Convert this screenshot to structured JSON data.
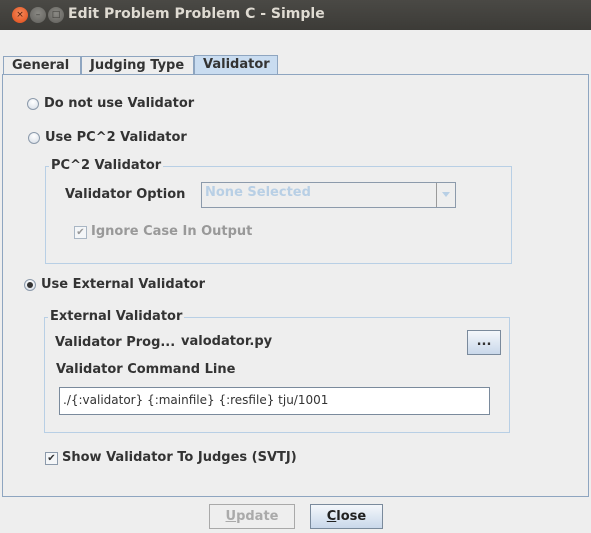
{
  "window": {
    "title": "Edit Problem Problem C - Simple",
    "close_glyph": "×",
    "minimize_glyph": "–",
    "maximize_glyph": "□"
  },
  "tabs": [
    {
      "label": "General",
      "active": false
    },
    {
      "label": "Judging Type",
      "active": false
    },
    {
      "label": "Validator",
      "active": true
    }
  ],
  "validator": {
    "option_none": {
      "label": "Do not use Validator",
      "selected": false
    },
    "option_pc2": {
      "label": "Use PC^2 Validator",
      "selected": false
    },
    "pc2_group": {
      "title": "PC^2 Validator",
      "option_label": "Validator Option",
      "option_value": "None Selected",
      "ignore_case_label": "Ignore Case In Output",
      "ignore_case_checked": true,
      "check_glyph": "✔"
    },
    "option_external": {
      "label": "Use External Validator",
      "selected": true
    },
    "external_group": {
      "title": "External Validator",
      "program_label": "Validator Prog...",
      "program_value": "valodator.py",
      "browse_label": "...",
      "command_label": "Validator Command Line",
      "command_value": "./{:validator}  {:mainfile}  {:resfile} tju/1001"
    },
    "show_to_judges_label": "Show Validator To Judges (SVTJ)",
    "show_to_judges_checked": true,
    "check_glyph": "✔"
  },
  "footer": {
    "update_label": "Update",
    "update_mnemonic": "U",
    "update_rest": "pdate",
    "close_label": "Close",
    "close_mnemonic": "C",
    "close_rest": "lose"
  }
}
